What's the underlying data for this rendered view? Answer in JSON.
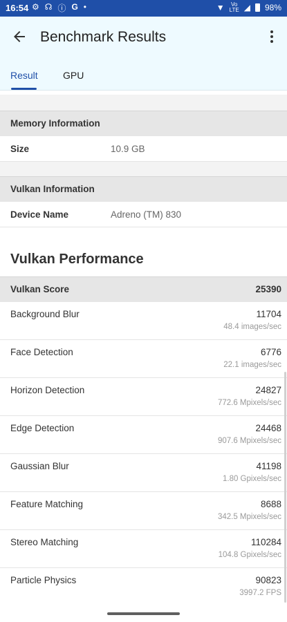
{
  "status": {
    "time": "16:54",
    "left_icons": [
      "gear-icon",
      "network-icon",
      "info-icon",
      "google-icon",
      "dot-icon"
    ],
    "lte_top": "Vo",
    "lte_bottom": "LTE",
    "battery": "98%"
  },
  "appbar": {
    "title": "Benchmark Results",
    "tabs": [
      {
        "label": "Result",
        "active": true
      },
      {
        "label": "GPU",
        "active": false
      }
    ]
  },
  "memory": {
    "header": "Memory Information",
    "rows": [
      {
        "key": "Size",
        "value": "10.9 GB"
      }
    ]
  },
  "vulkan_info": {
    "header": "Vulkan Information",
    "rows": [
      {
        "key": "Device Name",
        "value": "Adreno (TM) 830"
      }
    ]
  },
  "performance": {
    "title": "Vulkan Performance",
    "score_label": "Vulkan Score",
    "score_value": "25390",
    "items": [
      {
        "name": "Background Blur",
        "score": "11704",
        "rate": "48.4 images/sec"
      },
      {
        "name": "Face Detection",
        "score": "6776",
        "rate": "22.1 images/sec"
      },
      {
        "name": "Horizon Detection",
        "score": "24827",
        "rate": "772.6 Mpixels/sec"
      },
      {
        "name": "Edge Detection",
        "score": "24468",
        "rate": "907.6 Mpixels/sec"
      },
      {
        "name": "Gaussian Blur",
        "score": "41198",
        "rate": "1.80 Gpixels/sec"
      },
      {
        "name": "Feature Matching",
        "score": "8688",
        "rate": "342.5 Mpixels/sec"
      },
      {
        "name": "Stereo Matching",
        "score": "110284",
        "rate": "104.8 Gpixels/sec"
      },
      {
        "name": "Particle Physics",
        "score": "90823",
        "rate": "3997.2 FPS"
      }
    ]
  }
}
